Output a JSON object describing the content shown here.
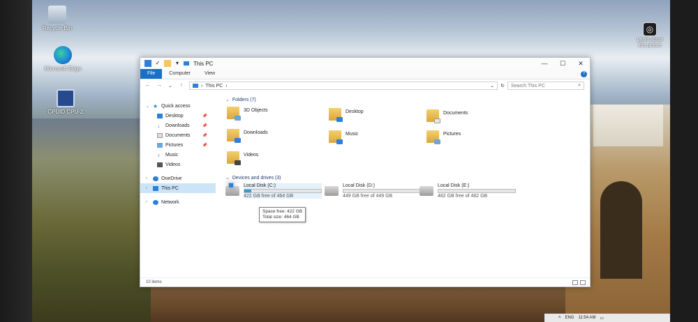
{
  "desktop_icons": {
    "recycle_bin": {
      "label": "Recycle Bin",
      "icon": "recycle-bin-icon"
    },
    "edge": {
      "label": "Microsoft Edge",
      "icon": "edge-icon"
    },
    "cpuz": {
      "label": "CPUID CPU-Z",
      "icon": "cpu-z-icon"
    },
    "learn": {
      "label": "Learn about this picture",
      "icon": "camera-icon"
    }
  },
  "window": {
    "title": "This PC",
    "controls": {
      "minimize": "—",
      "maximize": "☐",
      "close": "✕"
    }
  },
  "ribbon": {
    "tabs": [
      "File",
      "Computer",
      "View"
    ],
    "help": "?"
  },
  "address": {
    "path": "This PC",
    "search_placeholder": "Search This PC"
  },
  "nav": {
    "quick_access": "Quick access",
    "items": [
      {
        "label": "Desktop",
        "pinned": true
      },
      {
        "label": "Downloads",
        "pinned": true
      },
      {
        "label": "Documents",
        "pinned": true
      },
      {
        "label": "Pictures",
        "pinned": true
      },
      {
        "label": "Music",
        "pinned": false
      },
      {
        "label": "Videos",
        "pinned": false
      }
    ],
    "onedrive": "OneDrive",
    "this_pc": "This PC",
    "network": "Network"
  },
  "content": {
    "folders_header": "Folders (7)",
    "folders": [
      "3D Objects",
      "Desktop",
      "Documents",
      "Downloads",
      "Music",
      "Pictures",
      "Videos"
    ],
    "drives_header": "Devices and drives (3)",
    "drives": [
      {
        "name": "Local Disk (C:)",
        "free": "422 GB free of 464 GB",
        "used_fraction": 0.09
      },
      {
        "name": "Local Disk (D:)",
        "free": "449 GB free of 449 GB",
        "used_fraction": 0.0
      },
      {
        "name": "Local Disk (E:)",
        "free": "482 GB free of 482 GB",
        "used_fraction": 0.0
      }
    ],
    "tooltip": {
      "space_free": "Space free: 422 GB",
      "total_size": "Total size: 464 GB"
    }
  },
  "status": {
    "items": "10 items"
  },
  "taskbar": {
    "lang": "ENG",
    "time": "11:54 AM"
  },
  "colors": {
    "accent": "#1a6fc7",
    "selection": "#cce4f7",
    "drive_fill": "#26a0da"
  }
}
